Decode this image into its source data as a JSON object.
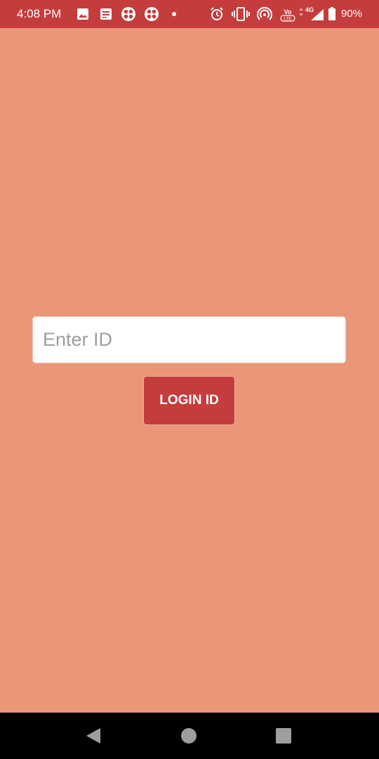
{
  "status_bar": {
    "time": "4:08 PM",
    "battery": "90%",
    "network": "4G",
    "notification_icons": [
      "image-icon",
      "news-icon",
      "app-icon",
      "app-icon",
      "dot-icon"
    ],
    "system_icons": [
      "alarm-icon",
      "vibrate-icon",
      "hotspot-icon",
      "volte-icon",
      "signal-icon",
      "battery-icon"
    ],
    "volte_label": "Vo LTE",
    "bar_color": "#C43C3C"
  },
  "main": {
    "background_color": "#EA9679",
    "id_input": {
      "placeholder": "Enter ID",
      "value": ""
    },
    "login_button": {
      "label": "LOGIN ID",
      "color": "#C43C3C"
    }
  },
  "nav_bar": {
    "buttons": [
      "back-icon",
      "home-icon",
      "recents-icon"
    ]
  }
}
